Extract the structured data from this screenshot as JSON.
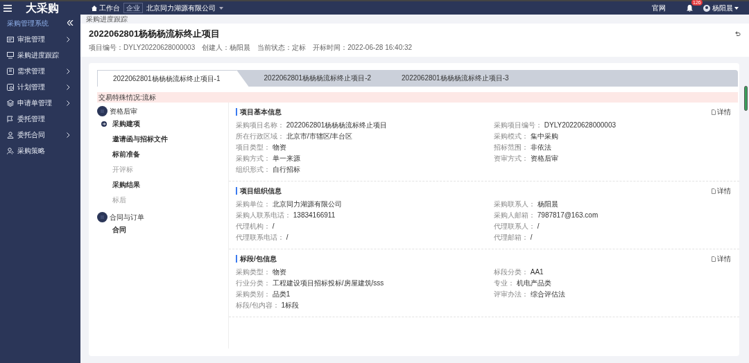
{
  "topbar": {
    "logo": "大采购",
    "workbench": "工作台",
    "org_tag": "企业",
    "org_name": "北京同力湖源有限公司",
    "site_link": "官网",
    "notifications": "126",
    "user": "杨阳晨"
  },
  "sidebar": {
    "title": "采购管理系统",
    "items": [
      {
        "label": "审批管理",
        "has_submenu": true
      },
      {
        "label": "采购进度跟踪",
        "has_submenu": false
      },
      {
        "label": "需求管理",
        "has_submenu": true
      },
      {
        "label": "计划管理",
        "has_submenu": true
      },
      {
        "label": "申请单管理",
        "has_submenu": true
      },
      {
        "label": "委托管理",
        "has_submenu": false
      },
      {
        "label": "委托合同",
        "has_submenu": true
      },
      {
        "label": "采购策略",
        "has_submenu": false
      }
    ]
  },
  "breadcrumb": "采购进度跟踪",
  "project": {
    "title": "2022062801杨杨杨流标终止项目",
    "meta": [
      {
        "label": "项目编号：",
        "value": "DYLY20220628000003"
      },
      {
        "label": "创建人：",
        "value": "杨阳晨"
      },
      {
        "label": "当前状态：",
        "value": "定标"
      },
      {
        "label": "开标时间：",
        "value": "2022-06-28 16:40:32"
      }
    ]
  },
  "tabs": [
    {
      "label": "2022062801杨杨杨流标终止项目-1",
      "selected": true
    },
    {
      "label": "2022062801杨杨杨流标终止项目-2",
      "selected": false
    },
    {
      "label": "2022062801杨杨杨流标终止项目-3",
      "selected": false
    }
  ],
  "alert": "交易特殊情况:流标",
  "steps": [
    {
      "group": "资格后审",
      "items": [
        {
          "label": "采购建项",
          "current": true,
          "disabled": false
        },
        {
          "label": "邀请函与招标文件",
          "current": false,
          "disabled": false
        },
        {
          "label": "标前准备",
          "current": false,
          "disabled": false
        },
        {
          "label": "开评标",
          "current": false,
          "disabled": true
        },
        {
          "label": "采购结果",
          "current": false,
          "disabled": false
        },
        {
          "label": "标后",
          "current": false,
          "disabled": true
        }
      ]
    },
    {
      "group": "合同与订单",
      "items": [
        {
          "label": "合同",
          "current": false,
          "disabled": false
        }
      ]
    }
  ],
  "sections": [
    {
      "title": "项目基本信息",
      "detail": "详情",
      "fields": [
        {
          "label": "采购项目名称：",
          "value": "2022062801杨杨杨流标终止项目"
        },
        {
          "label": "采购项目编号：",
          "value": "DYLY20220628000003"
        },
        {
          "label": "所在行政区域：",
          "value": "北京市/市辖区/丰台区"
        },
        {
          "label": "采购模式：",
          "value": "集中采购"
        },
        {
          "label": "项目类型：",
          "value": "物资"
        },
        {
          "label": "招标范围：",
          "value": "非依法"
        },
        {
          "label": "采购方式：",
          "value": "单一来源"
        },
        {
          "label": "资审方式：",
          "value": "资格后审"
        },
        {
          "label": "组织形式：",
          "value": "自行招标"
        }
      ]
    },
    {
      "title": "项目组织信息",
      "detail": "详情",
      "fields": [
        {
          "label": "采购单位：",
          "value": "北京同力湖源有限公司"
        },
        {
          "label": "采购联系人：",
          "value": "杨阳晨"
        },
        {
          "label": "采购人联系电话：",
          "value": "13834166911"
        },
        {
          "label": "采购人邮箱：",
          "value": "7987817@163.com"
        },
        {
          "label": "代理机构：",
          "value": "/"
        },
        {
          "label": "代理联系人：",
          "value": "/"
        },
        {
          "label": "代理联系电话：",
          "value": "/"
        },
        {
          "label": "代理邮箱：",
          "value": "/"
        }
      ]
    },
    {
      "title": "标段/包信息",
      "detail": "详情",
      "fields": [
        {
          "label": "采购类型：",
          "value": "物资"
        },
        {
          "label": "标段分类：",
          "value": "AA1"
        },
        {
          "label": "行业分类：",
          "value": "工程建设项目招标投标/房屋建筑/sss"
        },
        {
          "label": "专业：",
          "value": "机电产品类"
        },
        {
          "label": "采购类别：",
          "value": "品类1"
        },
        {
          "label": "评审办法：",
          "value": "综合评估法"
        },
        {
          "label": "标段/包内容：",
          "value": "1标段"
        }
      ]
    }
  ]
}
